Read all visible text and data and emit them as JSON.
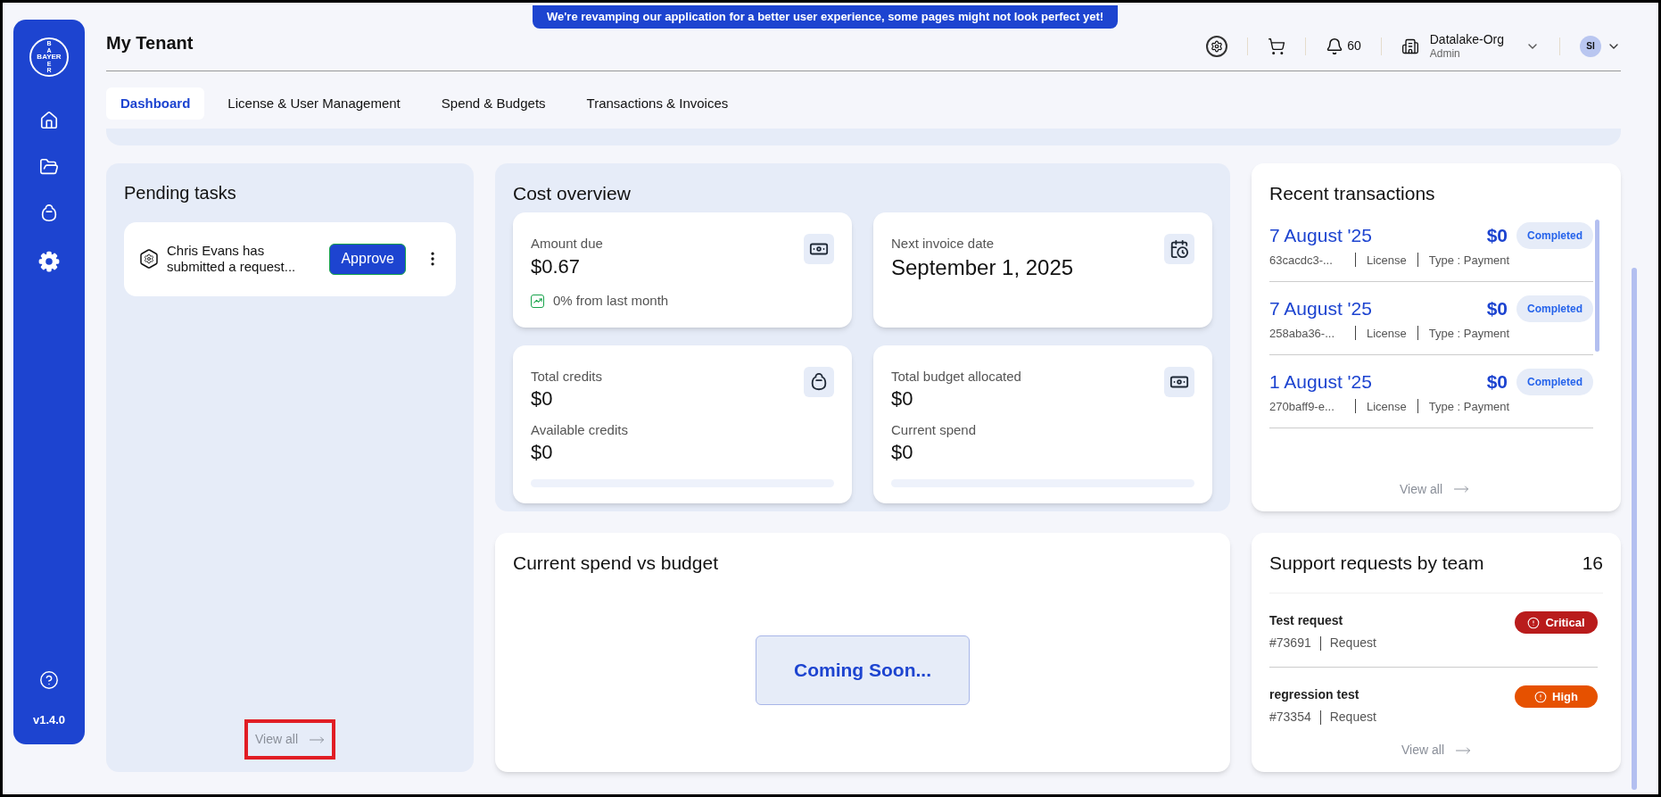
{
  "banner": "We're revamping our application for a better user experience, some pages might not look perfect yet!",
  "sidebar": {
    "logo": {
      "top": "BA",
      "middle": "BAYER",
      "bottom": "ER"
    },
    "nav_items": [
      {
        "kind": "home",
        "selected": false
      },
      {
        "kind": "folder",
        "selected": false
      },
      {
        "kind": "bag",
        "selected": false
      },
      {
        "kind": "settings",
        "selected": true
      }
    ],
    "version": "v1.4.0"
  },
  "header": {
    "title": "My Tenant",
    "notifications": "60",
    "org": {
      "name": "Datalake-Org",
      "role": "Admin"
    },
    "avatar": "SI"
  },
  "tabs": [
    {
      "label": "Dashboard",
      "selected": true
    },
    {
      "label": "License & User Management",
      "selected": false
    },
    {
      "label": "Spend & Budgets",
      "selected": false
    },
    {
      "label": "Transactions & Invoices",
      "selected": false
    }
  ],
  "pending_tasks": {
    "title": "Pending tasks",
    "tasks": [
      {
        "text": "Chris Evans has submitted a request...",
        "action": "Approve"
      }
    ],
    "view_all": "View all",
    "view_all_highlighted": true
  },
  "cost_overview": {
    "title": "Cost overview",
    "cards": [
      {
        "kind": "trend",
        "label": "Amount due",
        "value": "$0.67",
        "trend": "0% from last month"
      },
      {
        "kind": "date",
        "label": "Next invoice date",
        "value": "September 1, 2025"
      },
      {
        "kind": "split",
        "label": "Total credits",
        "value": "$0",
        "sub_label": "Available credits",
        "sub_value": "$0",
        "level": 0
      },
      {
        "kind": "split",
        "label": "Total budget allocated",
        "value": "$0",
        "sub_label": "Current spend",
        "sub_value": "$0",
        "level": 0
      }
    ]
  },
  "spend_vs_budget": {
    "title": "Current spend vs budget",
    "status": "Coming Soon..."
  },
  "recent_transactions": {
    "title": "Recent transactions",
    "rows": [
      {
        "date": "7 August '25",
        "amount": "$0",
        "status": "Completed",
        "id": "63cacdc3-...",
        "category": "License",
        "type": "Type : Payment"
      },
      {
        "date": "7 August '25",
        "amount": "$0",
        "status": "Completed",
        "id": "258aba36-...",
        "category": "License",
        "type": "Type : Payment"
      },
      {
        "date": "1 August '25",
        "amount": "$0",
        "status": "Completed",
        "id": "270baff9-e...",
        "category": "License",
        "type": "Type : Payment"
      }
    ],
    "view_all": "View all"
  },
  "support_requests": {
    "title": "Support requests by team",
    "count": "16",
    "rows": [
      {
        "title": "Test request",
        "id": "#73691",
        "category": "Request",
        "priority": "Critical",
        "color": "#b91c1c"
      },
      {
        "title": "regression test",
        "id": "#73354",
        "category": "Request",
        "priority": "High",
        "color": "#e65100"
      }
    ],
    "view_all": "View all"
  }
}
